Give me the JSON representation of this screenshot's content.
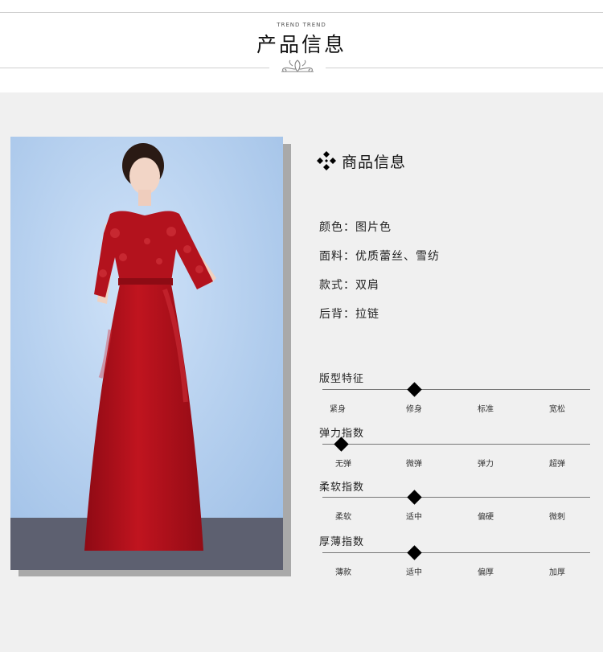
{
  "header": {
    "trend_text": "TREND TREND",
    "title": "产品信息"
  },
  "info": {
    "heading": "商品信息",
    "specs": [
      {
        "text": "颜色：图片色"
      },
      {
        "text": "面料：优质蕾丝、雪纺"
      },
      {
        "text": "款式：双肩"
      },
      {
        "text": "后背：拉链"
      }
    ]
  },
  "meters": [
    {
      "title": "版型特征",
      "labels": [
        "紧身",
        "修身",
        "标准",
        "宽松"
      ],
      "selected": 1
    },
    {
      "title": "弹力指数",
      "labels": [
        "无弹",
        "微弹",
        "弹力",
        "超弹"
      ],
      "selected": 0
    },
    {
      "title": "柔软指数",
      "labels": [
        "柔软",
        "适中",
        "偏硬",
        "微刺"
      ],
      "selected": 1
    },
    {
      "title": "厚薄指数",
      "labels": [
        "薄款",
        "适中",
        "偏厚",
        "加厚"
      ],
      "selected": 1
    }
  ],
  "colors": {
    "dress": "#b3121d",
    "backdrop": "#a8c6ea",
    "floor": "#5d6070",
    "page_gray": "#f0f0f0"
  },
  "icons": {
    "ornament": "floral-ornament-icon",
    "heading_bullet": "four-diamond-icon"
  }
}
